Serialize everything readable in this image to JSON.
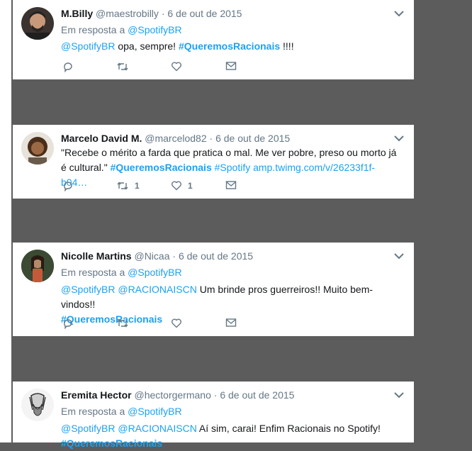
{
  "tweets": [
    {
      "name": "M.Billy",
      "handle": "@maestrobilly",
      "dot": "·",
      "date": "6 de out de 2015",
      "reply_prefix": "Em resposta a",
      "reply_to": "@SpotifyBR",
      "text": {
        "mention": "@SpotifyBR",
        "t1": " opa, sempre! ",
        "hashtag": "#QueremosRacionais",
        "t2": " !!!!"
      },
      "actions": {
        "reply_icon": "reply-icon",
        "retweet_icon": "retweet-icon",
        "like_icon": "heart-icon",
        "dm_icon": "envelope-icon"
      }
    },
    {
      "name": "Marcelo David M.",
      "handle": "@marcelod82",
      "dot": "·",
      "date": "6 de out de 2015",
      "text": {
        "quote": "\"Recebe o mérito a farda que pratica o mal. Me ver pobre, preso ou morto já é cultural.\"",
        "hashtag1": "#QueremosRacionais",
        "hashtag2": "#Spotify",
        "url": "amp.twimg.com/v/26233f1f-b04…"
      },
      "retweet_count": "1",
      "like_count": "1"
    },
    {
      "name": "Nicolle Martins",
      "handle": "@Nicaa",
      "dot": "·",
      "date": "6 de out de 2015",
      "reply_prefix": "Em resposta a",
      "reply_to": "@SpotifyBR",
      "text": {
        "mention1": "@SpotifyBR",
        "mention2": "@RACIONAISCN",
        "t1": " Um brinde pros guerreiros!! Muito bem-vindos!!",
        "hashtag": "#QueremosRacionais"
      }
    },
    {
      "name": "Eremita Hector",
      "handle": "@hectorgermano",
      "dot": "·",
      "date": "6 de out de 2015",
      "reply_prefix": "Em resposta a",
      "reply_to": "@SpotifyBR",
      "text": {
        "mention1": "@SpotifyBR",
        "mention2": "@RACIONAISCN",
        "t1": " Aí sim, carai! Enfim Racionais no Spotify!",
        "hashtag": "#QueremosRacionais"
      }
    }
  ],
  "colors": {
    "background": "#5c5c5c",
    "link": "#1da1f2",
    "secondary": "#657786",
    "primary": "#14171a"
  }
}
